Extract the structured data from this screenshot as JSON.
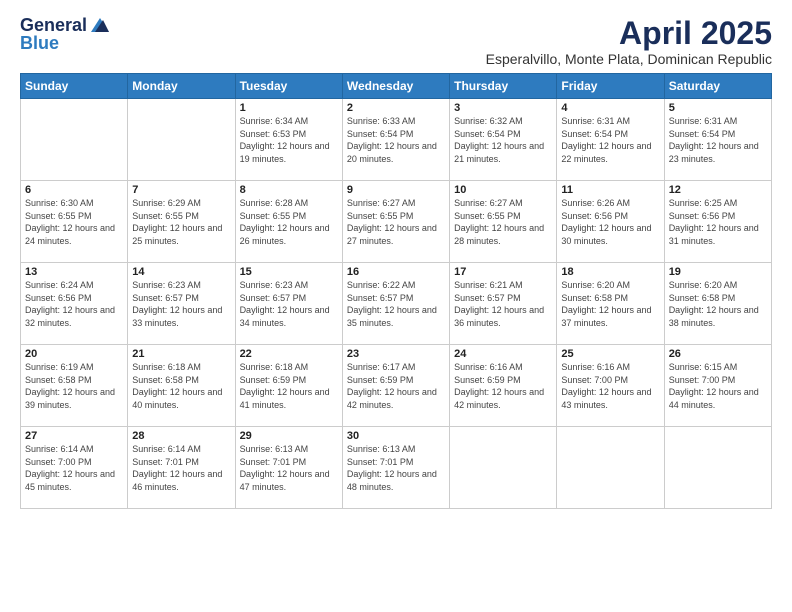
{
  "logo": {
    "general": "General",
    "blue": "Blue"
  },
  "title": {
    "month_year": "April 2025",
    "location": "Esperalvillo, Monte Plata, Dominican Republic"
  },
  "days_of_week": [
    "Sunday",
    "Monday",
    "Tuesday",
    "Wednesday",
    "Thursday",
    "Friday",
    "Saturday"
  ],
  "weeks": [
    [
      {
        "day": "",
        "info": ""
      },
      {
        "day": "",
        "info": ""
      },
      {
        "day": "1",
        "info": "Sunrise: 6:34 AM\nSunset: 6:53 PM\nDaylight: 12 hours and 19 minutes."
      },
      {
        "day": "2",
        "info": "Sunrise: 6:33 AM\nSunset: 6:54 PM\nDaylight: 12 hours and 20 minutes."
      },
      {
        "day": "3",
        "info": "Sunrise: 6:32 AM\nSunset: 6:54 PM\nDaylight: 12 hours and 21 minutes."
      },
      {
        "day": "4",
        "info": "Sunrise: 6:31 AM\nSunset: 6:54 PM\nDaylight: 12 hours and 22 minutes."
      },
      {
        "day": "5",
        "info": "Sunrise: 6:31 AM\nSunset: 6:54 PM\nDaylight: 12 hours and 23 minutes."
      }
    ],
    [
      {
        "day": "6",
        "info": "Sunrise: 6:30 AM\nSunset: 6:55 PM\nDaylight: 12 hours and 24 minutes."
      },
      {
        "day": "7",
        "info": "Sunrise: 6:29 AM\nSunset: 6:55 PM\nDaylight: 12 hours and 25 minutes."
      },
      {
        "day": "8",
        "info": "Sunrise: 6:28 AM\nSunset: 6:55 PM\nDaylight: 12 hours and 26 minutes."
      },
      {
        "day": "9",
        "info": "Sunrise: 6:27 AM\nSunset: 6:55 PM\nDaylight: 12 hours and 27 minutes."
      },
      {
        "day": "10",
        "info": "Sunrise: 6:27 AM\nSunset: 6:55 PM\nDaylight: 12 hours and 28 minutes."
      },
      {
        "day": "11",
        "info": "Sunrise: 6:26 AM\nSunset: 6:56 PM\nDaylight: 12 hours and 30 minutes."
      },
      {
        "day": "12",
        "info": "Sunrise: 6:25 AM\nSunset: 6:56 PM\nDaylight: 12 hours and 31 minutes."
      }
    ],
    [
      {
        "day": "13",
        "info": "Sunrise: 6:24 AM\nSunset: 6:56 PM\nDaylight: 12 hours and 32 minutes."
      },
      {
        "day": "14",
        "info": "Sunrise: 6:23 AM\nSunset: 6:57 PM\nDaylight: 12 hours and 33 minutes."
      },
      {
        "day": "15",
        "info": "Sunrise: 6:23 AM\nSunset: 6:57 PM\nDaylight: 12 hours and 34 minutes."
      },
      {
        "day": "16",
        "info": "Sunrise: 6:22 AM\nSunset: 6:57 PM\nDaylight: 12 hours and 35 minutes."
      },
      {
        "day": "17",
        "info": "Sunrise: 6:21 AM\nSunset: 6:57 PM\nDaylight: 12 hours and 36 minutes."
      },
      {
        "day": "18",
        "info": "Sunrise: 6:20 AM\nSunset: 6:58 PM\nDaylight: 12 hours and 37 minutes."
      },
      {
        "day": "19",
        "info": "Sunrise: 6:20 AM\nSunset: 6:58 PM\nDaylight: 12 hours and 38 minutes."
      }
    ],
    [
      {
        "day": "20",
        "info": "Sunrise: 6:19 AM\nSunset: 6:58 PM\nDaylight: 12 hours and 39 minutes."
      },
      {
        "day": "21",
        "info": "Sunrise: 6:18 AM\nSunset: 6:58 PM\nDaylight: 12 hours and 40 minutes."
      },
      {
        "day": "22",
        "info": "Sunrise: 6:18 AM\nSunset: 6:59 PM\nDaylight: 12 hours and 41 minutes."
      },
      {
        "day": "23",
        "info": "Sunrise: 6:17 AM\nSunset: 6:59 PM\nDaylight: 12 hours and 42 minutes."
      },
      {
        "day": "24",
        "info": "Sunrise: 6:16 AM\nSunset: 6:59 PM\nDaylight: 12 hours and 42 minutes."
      },
      {
        "day": "25",
        "info": "Sunrise: 6:16 AM\nSunset: 7:00 PM\nDaylight: 12 hours and 43 minutes."
      },
      {
        "day": "26",
        "info": "Sunrise: 6:15 AM\nSunset: 7:00 PM\nDaylight: 12 hours and 44 minutes."
      }
    ],
    [
      {
        "day": "27",
        "info": "Sunrise: 6:14 AM\nSunset: 7:00 PM\nDaylight: 12 hours and 45 minutes."
      },
      {
        "day": "28",
        "info": "Sunrise: 6:14 AM\nSunset: 7:01 PM\nDaylight: 12 hours and 46 minutes."
      },
      {
        "day": "29",
        "info": "Sunrise: 6:13 AM\nSunset: 7:01 PM\nDaylight: 12 hours and 47 minutes."
      },
      {
        "day": "30",
        "info": "Sunrise: 6:13 AM\nSunset: 7:01 PM\nDaylight: 12 hours and 48 minutes."
      },
      {
        "day": "",
        "info": ""
      },
      {
        "day": "",
        "info": ""
      },
      {
        "day": "",
        "info": ""
      }
    ]
  ]
}
